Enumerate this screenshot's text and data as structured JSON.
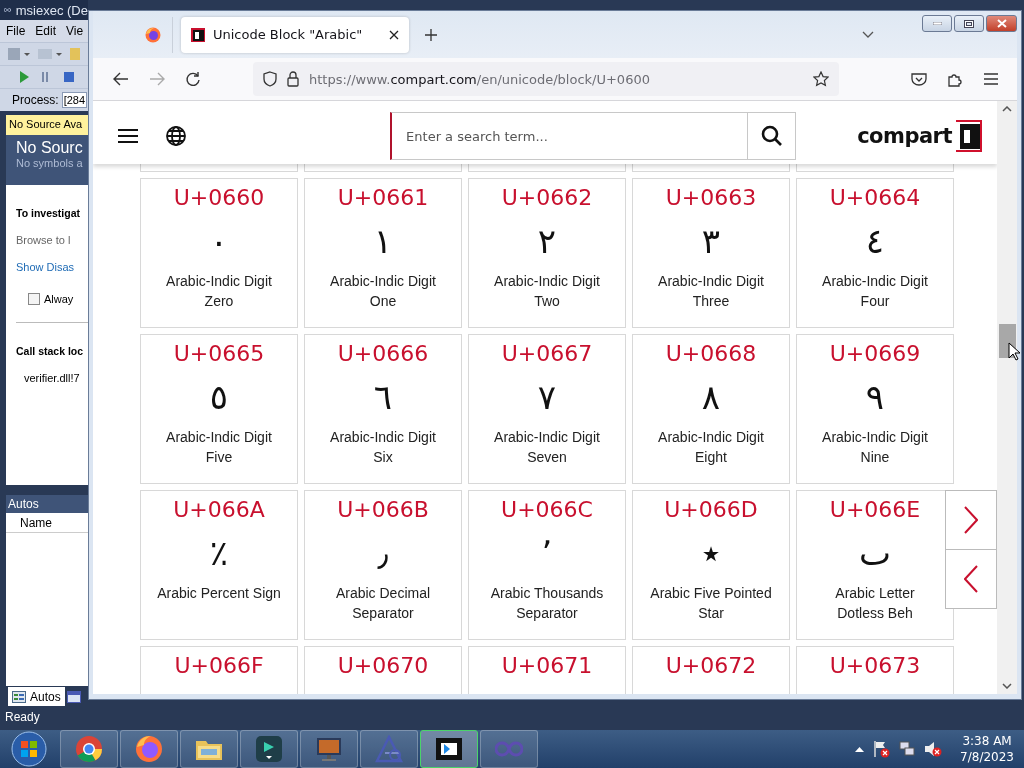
{
  "vs_window": {
    "title": "msiexec (De",
    "menu": [
      "File",
      "Edit",
      "Vie"
    ],
    "process_label": "Process:",
    "process_value": "[284",
    "document_tab": {
      "label": "No Source Ava",
      "selected": true
    },
    "header_title": "No Sourc",
    "header_subtitle": "No symbols a",
    "investigate_heading": "To investigat",
    "browse_text": "Browse to l",
    "disassembly_link": "Show Disas",
    "always_checkbox": {
      "label": "Alway",
      "checked": false
    },
    "call_stack_heading": "Call stack loc",
    "call_stack_location": "verifier.dll!7",
    "autos_title": "Autos",
    "autos_column": "Name",
    "bottom_tab": {
      "label": "Autos",
      "selected": true
    },
    "status": "Ready"
  },
  "browser": {
    "tabs": [
      {
        "title": "Unicode Block \"Arabic\"",
        "selected": true
      }
    ],
    "url": {
      "prefix": "https://www.",
      "domain": "compart.com",
      "path": "/en/unicode/block/U+0600"
    },
    "page": {
      "search_placeholder": "Enter a search term...",
      "logo": "compart",
      "rows": [
        [
          {
            "code": "U+0660",
            "glyph": "٠",
            "name": "Arabic-Indic Digit Zero"
          },
          {
            "code": "U+0661",
            "glyph": "١",
            "name": "Arabic-Indic Digit One"
          },
          {
            "code": "U+0662",
            "glyph": "٢",
            "name": "Arabic-Indic Digit Two"
          },
          {
            "code": "U+0663",
            "glyph": "٣",
            "name": "Arabic-Indic Digit Three"
          },
          {
            "code": "U+0664",
            "glyph": "٤",
            "name": "Arabic-Indic Digit Four"
          }
        ],
        [
          {
            "code": "U+0665",
            "glyph": "٥",
            "name": "Arabic-Indic Digit Five"
          },
          {
            "code": "U+0666",
            "glyph": "٦",
            "name": "Arabic-Indic Digit Six"
          },
          {
            "code": "U+0667",
            "glyph": "٧",
            "name": "Arabic-Indic Digit Seven"
          },
          {
            "code": "U+0668",
            "glyph": "٨",
            "name": "Arabic-Indic Digit Eight"
          },
          {
            "code": "U+0669",
            "glyph": "٩",
            "name": "Arabic-Indic Digit Nine"
          }
        ],
        [
          {
            "code": "U+066A",
            "glyph": "٪",
            "name": "Arabic Percent Sign"
          },
          {
            "code": "U+066B",
            "glyph": "٫",
            "name": "Arabic Decimal Separator"
          },
          {
            "code": "U+066C",
            "glyph": "٬",
            "name": "Arabic Thousands Separator"
          },
          {
            "code": "U+066D",
            "glyph": "٭",
            "name": "Arabic Five Pointed Star"
          },
          {
            "code": "U+066E",
            "glyph": "ٮ",
            "name": "Arabic Letter Dotless Beh"
          }
        ],
        [
          {
            "code": "U+066F"
          },
          {
            "code": "U+0670"
          },
          {
            "code": "U+0671"
          },
          {
            "code": "U+0672"
          },
          {
            "code": "U+0673"
          }
        ]
      ]
    }
  },
  "taskbar": {
    "apps": [
      {
        "kind": "circle",
        "active": false
      },
      {
        "kind": "fox",
        "active": false
      },
      {
        "kind": "folder",
        "active": false
      },
      {
        "kind": "editor",
        "active": false
      },
      {
        "kind": "monitor",
        "active": false
      },
      {
        "kind": "triangle",
        "active": false
      },
      {
        "kind": "film",
        "active": true
      },
      {
        "kind": "infinity",
        "active": false
      }
    ],
    "time": "3:38 AM",
    "date": "7/8/2023"
  }
}
